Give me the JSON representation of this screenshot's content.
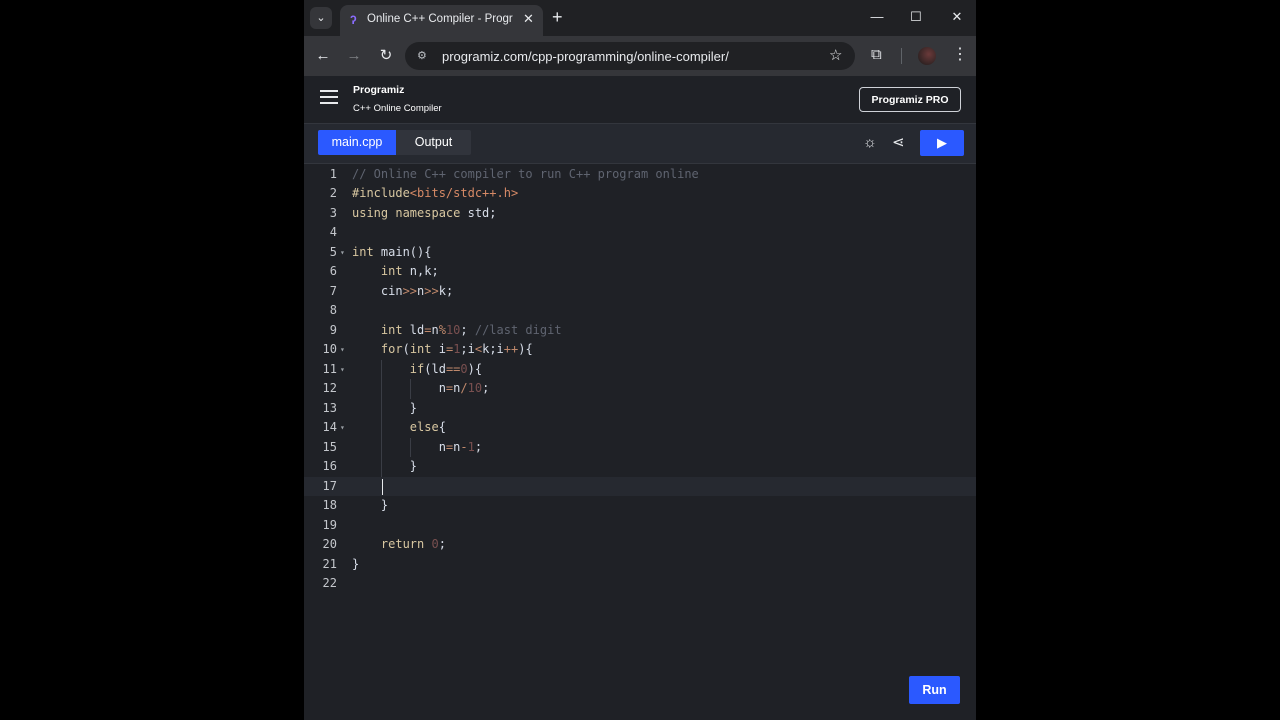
{
  "browser": {
    "tab_title": "Online C++ Compiler - Program",
    "url": "programiz.com/cpp-programming/online-compiler/",
    "icons": {
      "tab_list": "chevron-down-icon",
      "favicon": "programiz-favicon",
      "close": "close-icon",
      "new_tab": "plus-icon",
      "back": "arrow-left-icon",
      "forward": "arrow-right-icon",
      "reload": "reload-icon",
      "site_info": "tune-icon",
      "bookmark": "star-icon",
      "extensions": "puzzle-icon",
      "menu": "kebab-icon"
    }
  },
  "site": {
    "logo_text": "Programiz",
    "subtitle": "C++ Online Compiler",
    "pro_button": "Programiz PRO"
  },
  "editor_tabs": {
    "main": "main.cpp",
    "output": "Output"
  },
  "editor": {
    "active_line": 17,
    "lines": [
      {
        "n": "1",
        "tokens": [
          [
            "c-com",
            "// Online C++ compiler to run C++ program online"
          ]
        ]
      },
      {
        "n": "2",
        "tokens": [
          [
            "c-kw",
            "#include"
          ],
          [
            "c-inc",
            "<bits/stdc++.h>"
          ]
        ]
      },
      {
        "n": "3",
        "tokens": [
          [
            "c-kw",
            "using namespace "
          ],
          [
            "c-txt",
            "std;"
          ]
        ]
      },
      {
        "n": "4",
        "tokens": []
      },
      {
        "n": "5",
        "fold": true,
        "tokens": [
          [
            "c-kw",
            "int "
          ],
          [
            "c-txt",
            "main(){"
          ]
        ]
      },
      {
        "n": "6",
        "indent": 1,
        "tokens": [
          [
            "c-kw",
            "    int "
          ],
          [
            "c-txt",
            "n,k;"
          ]
        ]
      },
      {
        "n": "7",
        "indent": 1,
        "tokens": [
          [
            "c-txt",
            "    cin"
          ],
          [
            "c-op",
            ">>"
          ],
          [
            "c-txt",
            "n"
          ],
          [
            "c-op",
            ">>"
          ],
          [
            "c-txt",
            "k;"
          ]
        ]
      },
      {
        "n": "8",
        "indent": 1,
        "tokens": []
      },
      {
        "n": "9",
        "indent": 1,
        "tokens": [
          [
            "c-kw",
            "    int "
          ],
          [
            "c-txt",
            "ld"
          ],
          [
            "c-op",
            "="
          ],
          [
            "c-txt",
            "n"
          ],
          [
            "c-op",
            "%"
          ],
          [
            "c-num",
            "10"
          ],
          [
            "c-txt",
            "; "
          ],
          [
            "c-com",
            "//last digit"
          ]
        ]
      },
      {
        "n": "10",
        "indent": 1,
        "fold": true,
        "tokens": [
          [
            "c-kw",
            "    for"
          ],
          [
            "c-txt",
            "("
          ],
          [
            "c-kw",
            "int "
          ],
          [
            "c-txt",
            "i"
          ],
          [
            "c-op",
            "="
          ],
          [
            "c-num",
            "1"
          ],
          [
            "c-txt",
            ";i"
          ],
          [
            "c-op",
            "<"
          ],
          [
            "c-txt",
            "k;i"
          ],
          [
            "c-op",
            "++"
          ],
          [
            "c-txt",
            "){"
          ]
        ]
      },
      {
        "n": "11",
        "indent": 2,
        "fold": true,
        "tokens": [
          [
            "c-kw",
            "        if"
          ],
          [
            "c-txt",
            "(ld"
          ],
          [
            "c-op",
            "=="
          ],
          [
            "c-num",
            "0"
          ],
          [
            "c-txt",
            "){"
          ]
        ]
      },
      {
        "n": "12",
        "indent": 3,
        "tokens": [
          [
            "c-txt",
            "            n"
          ],
          [
            "c-op",
            "="
          ],
          [
            "c-txt",
            "n"
          ],
          [
            "c-op",
            "/"
          ],
          [
            "c-num",
            "10"
          ],
          [
            "c-txt",
            ";"
          ]
        ]
      },
      {
        "n": "13",
        "indent": 2,
        "tokens": [
          [
            "c-txt",
            "        }"
          ]
        ]
      },
      {
        "n": "14",
        "indent": 2,
        "fold": true,
        "tokens": [
          [
            "c-kw",
            "        else"
          ],
          [
            "c-txt",
            "{"
          ]
        ]
      },
      {
        "n": "15",
        "indent": 3,
        "tokens": [
          [
            "c-txt",
            "            n"
          ],
          [
            "c-op",
            "="
          ],
          [
            "c-txt",
            "n"
          ],
          [
            "c-op",
            "-"
          ],
          [
            "c-num",
            "1"
          ],
          [
            "c-txt",
            ";"
          ]
        ]
      },
      {
        "n": "16",
        "indent": 2,
        "tokens": [
          [
            "c-txt",
            "        }"
          ]
        ]
      },
      {
        "n": "17",
        "indent": 1,
        "tokens": []
      },
      {
        "n": "18",
        "indent": 1,
        "tokens": [
          [
            "c-txt",
            "    }"
          ]
        ]
      },
      {
        "n": "19",
        "indent": 1,
        "tokens": []
      },
      {
        "n": "20",
        "indent": 1,
        "tokens": [
          [
            "c-kw",
            "    return "
          ],
          [
            "c-num",
            "0"
          ],
          [
            "c-txt",
            ";"
          ]
        ]
      },
      {
        "n": "21",
        "tokens": [
          [
            "c-txt",
            "}"
          ]
        ]
      },
      {
        "n": "22",
        "tokens": []
      }
    ]
  },
  "run_button": "Run"
}
